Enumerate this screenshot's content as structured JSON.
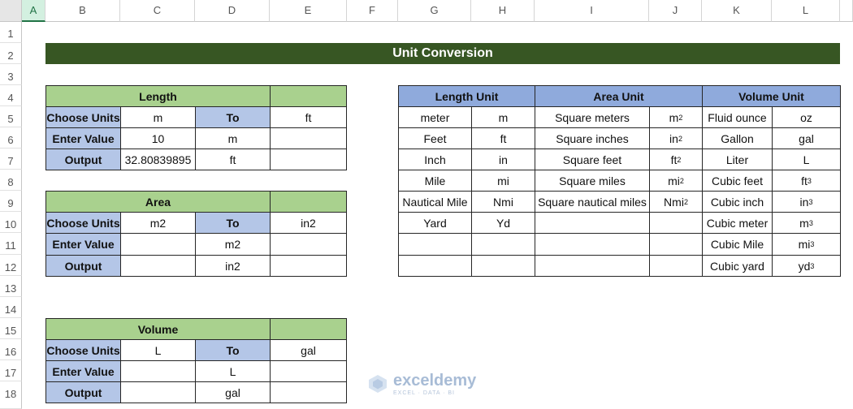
{
  "columns": [
    "A",
    "B",
    "C",
    "D",
    "E",
    "F",
    "G",
    "H",
    "I",
    "J",
    "K",
    "L"
  ],
  "rows": [
    "1",
    "2",
    "3",
    "4",
    "5",
    "6",
    "7",
    "8",
    "9",
    "10",
    "11",
    "12",
    "13",
    "14",
    "15",
    "16",
    "17",
    "18"
  ],
  "title": "Unit Conversion",
  "length_block": {
    "header": "Length",
    "labels": [
      "Choose Units",
      "Enter Value",
      "Output"
    ],
    "to_label": "To",
    "c": [
      "m",
      "10",
      "32.80839895"
    ],
    "d": [
      "m",
      "ft"
    ],
    "e": [
      "ft",
      "",
      ""
    ]
  },
  "area_block": {
    "header": "Area",
    "labels": [
      "Choose Units",
      "Enter Value",
      "Output"
    ],
    "to_label": "To",
    "c": [
      "m2",
      "",
      ""
    ],
    "d": [
      "m2",
      "in2"
    ],
    "e": [
      "in2",
      "",
      ""
    ]
  },
  "volume_block": {
    "header": "Volume",
    "labels": [
      "Choose Units",
      "Enter Value",
      "Output"
    ],
    "to_label": "To",
    "c": [
      "L",
      "",
      ""
    ],
    "d": [
      "L",
      "gal"
    ],
    "e": [
      "gal",
      "",
      ""
    ]
  },
  "unit_table": {
    "headers": [
      "Length Unit",
      "Area Unit",
      "Volume Unit"
    ],
    "length_names": [
      "meter",
      "Feet",
      "Inch",
      "Mile",
      "Nautical Mile",
      "Yard",
      "",
      ""
    ],
    "length_abbr": [
      "m",
      "ft",
      "in",
      "mi",
      "Nmi",
      "Yd",
      "",
      ""
    ],
    "area_names": [
      "Square meters",
      "Square inches",
      "Square feet",
      "Square miles",
      "Square nautical miles",
      "",
      "",
      ""
    ],
    "area_abbr": [
      "m",
      "in",
      "ft",
      "mi",
      "Nmi",
      "",
      "",
      ""
    ],
    "area_sup": [
      "2",
      "2",
      "2",
      "2",
      "2",
      "",
      "",
      ""
    ],
    "volume_names": [
      "Fluid ounce",
      "Gallon",
      "Liter",
      "Cubic feet",
      "Cubic inch",
      "Cubic meter",
      "Cubic Mile",
      "Cubic yard"
    ],
    "volume_abbr": [
      "oz",
      "gal",
      "L",
      "ft",
      "in",
      "m",
      "mi",
      "yd"
    ],
    "volume_sup": [
      "",
      "",
      "",
      "3",
      "3",
      "3",
      "3",
      "3"
    ]
  },
  "watermark": {
    "name": "exceldemy",
    "tagline": "EXCEL · DATA · BI"
  }
}
